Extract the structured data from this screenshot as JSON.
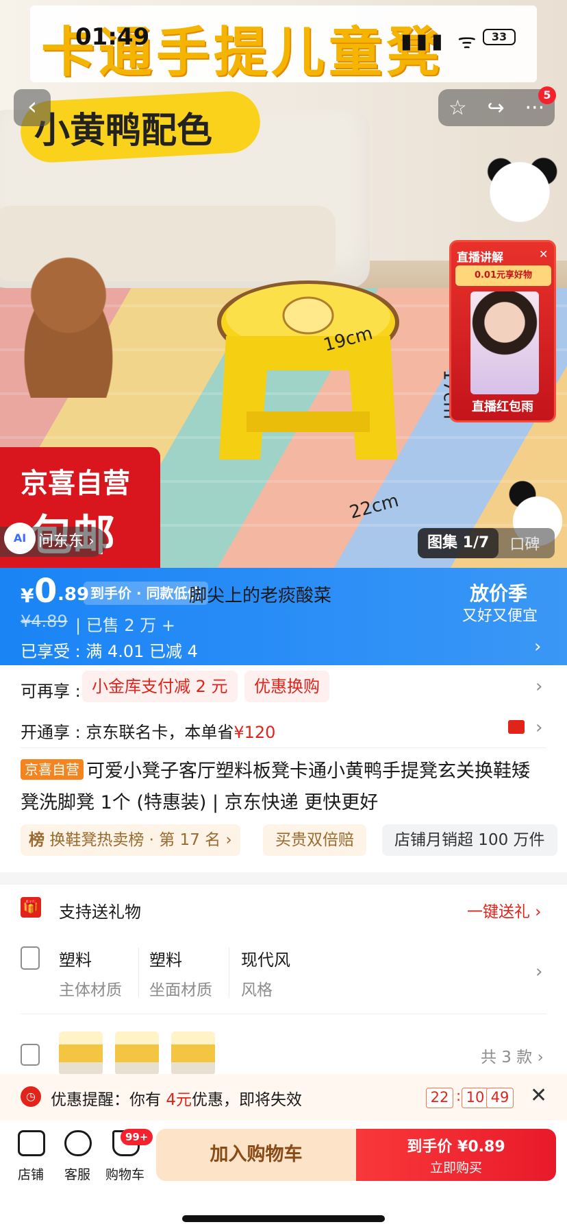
{
  "status": {
    "time": "01:49",
    "battery": "33"
  },
  "hero": {
    "banner": "卡通手提儿童凳",
    "tag": "小黄鸭配色",
    "dim_top": "19cm",
    "dim_side": "17cm",
    "dim_bottom": "22cm",
    "promo_line1": "京喜自营",
    "promo_line2": "包邮",
    "ask_ai": "AI",
    "ask_label": "问东东 ›",
    "gallery_current": "图集 1/7",
    "gallery_other": "口碑",
    "cart_badge": "5"
  },
  "live": {
    "top": "直播讲解",
    "banner": "0.01元享好物",
    "bottom": "直播红包雨"
  },
  "price": {
    "yen": "¥",
    "integer": "0",
    "decimal": ".89",
    "tag": "到手价 · 同款低价",
    "ticker": "脚尖上的老痰酸菜",
    "original": "¥4.89",
    "sold": "| 已售 2 万 +",
    "enjoyed": "已享受 : 满 4.01 已减 4",
    "promo_title": "放价季",
    "promo_sub": "又好又便宜"
  },
  "more": {
    "label": "可再享 :",
    "pill1": "小金库支付减 2 元",
    "pill2": "优惠换购"
  },
  "membership": {
    "label": "开通享 : 京东联名卡，本单省",
    "amount": "¥120"
  },
  "product": {
    "tag": "京喜自营",
    "title": "可爱小凳子客厅塑料板凳卡通小黄鸭手提凳玄关换鞋矮凳洗脚凳 1个 (特惠装) | 京东快递 更快更好"
  },
  "badges": {
    "rank_icon": "榜",
    "rank": "换鞋凳热卖榜 · 第 17 名 ›",
    "double": "买贵双倍赔",
    "monthly": "店铺月销超 100 万件"
  },
  "gift": {
    "label": "支持送礼物",
    "action": "一键送礼 ›"
  },
  "attributes": [
    {
      "value": "塑料",
      "key": "主体材质"
    },
    {
      "value": "塑料",
      "key": "坐面材质"
    },
    {
      "value": "现代风",
      "key": "风格"
    }
  ],
  "sku": {
    "count": "共 3 款 ›"
  },
  "reminder": {
    "label": "优惠提醒：你有",
    "amount": "4元",
    "suffix": "优惠，即将失效",
    "h": "22",
    "m": "10",
    "s": "49"
  },
  "bottom": {
    "store": "店铺",
    "service": "客服",
    "cart": "购物车",
    "cart_badge": "99+",
    "add_cart": "加入购物车",
    "buy_price": "到手价 ¥0.89",
    "buy_now": "立即购买"
  },
  "colors": {
    "accent_blue": "#1a84f5",
    "accent_red": "#e2231a"
  }
}
